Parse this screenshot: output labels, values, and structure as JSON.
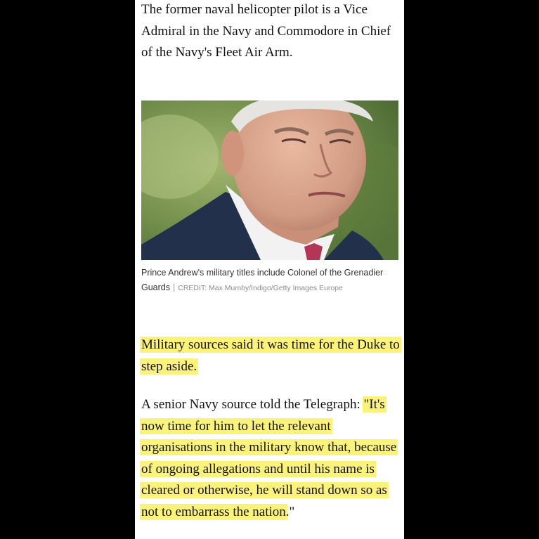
{
  "article": {
    "intro": "The former naval helicopter pilot is a Vice Admiral in the Navy and Commodore in Chief of the Navy's Fleet Air Arm.",
    "photo": {
      "subject_icon": "portrait-photo",
      "caption": "Prince Andrew's military titles include Colonel of the Grenadier Guards",
      "credit": "CREDIT: Max Mumby/Indigo/Getty Images Europe"
    },
    "paragraph1": {
      "highlighted": "Military sources said it was time for the Duke to step aside."
    },
    "paragraph2": {
      "lead": "A senior Navy source told the Telegraph:",
      "highlighted": "\"It's now time for him to let the relevant organisations in the military know that, because of ongoing allegations and until his name is cleared or otherwise, he will stand down so as not to embarrass the nation",
      "tail": ".\""
    }
  },
  "colors": {
    "frame": "#000000",
    "page": "#ffffff",
    "highlight": "#fbf27a",
    "text": "#121212"
  }
}
